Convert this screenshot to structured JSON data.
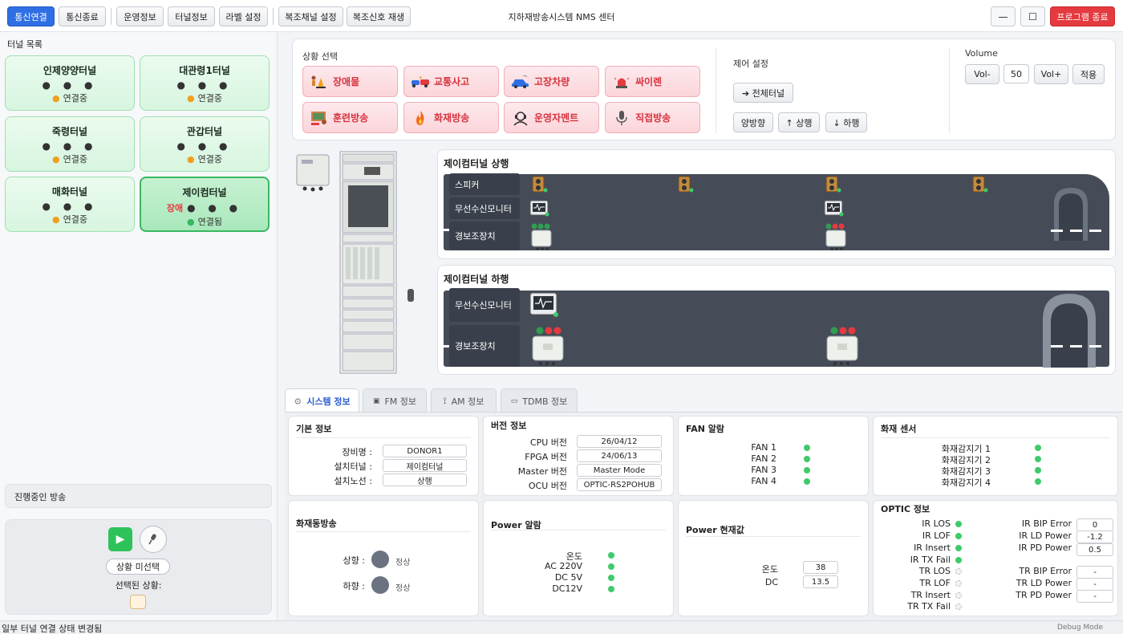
{
  "toolbar": {
    "connect": "통신연결",
    "disconnect": "통신종료",
    "ops_info": "운영정보",
    "tunnel_info": "터널정보",
    "label_settings": "라벨 설정",
    "sub_channel_settings": "복조채널 설정",
    "sub_signal_replay": "복조신호 재생"
  },
  "window": {
    "title": "지하재방송시스템 NMS 센터",
    "minimize": "—",
    "maximize": "☐",
    "exit": "프로그램 종료"
  },
  "tunnel_list": {
    "title": "터널 목록",
    "items": [
      {
        "name": "인제양양터널",
        "dots": "● ● ●",
        "status": "연결중",
        "alarm": ""
      },
      {
        "name": "대관령1터널",
        "dots": "● ● ●",
        "status": "연결중",
        "alarm": ""
      },
      {
        "name": "죽령터널",
        "dots": "● ● ●",
        "status": "연결중",
        "alarm": ""
      },
      {
        "name": "관갑터널",
        "dots": "● ● ●",
        "status": "연결중",
        "alarm": ""
      },
      {
        "name": "매화터널",
        "dots": "● ● ●",
        "status": "연결중",
        "alarm": ""
      },
      {
        "name": "제이컴터널",
        "dots": "● ● ●",
        "status": "연결됨",
        "alarm": "장애"
      }
    ]
  },
  "live_broadcast": {
    "title": "진행중인 방송"
  },
  "control": {
    "no_selection": "상황 미선택",
    "selected_label": "선택된 상황:"
  },
  "scenario": {
    "title": "상황 선택",
    "buttons": [
      {
        "label": "장애물",
        "icon": "obstacle-icon"
      },
      {
        "label": "교통사고",
        "icon": "car-crash-icon"
      },
      {
        "label": "고장차량",
        "icon": "broken-car-icon"
      },
      {
        "label": "싸이렌",
        "icon": "siren-icon"
      },
      {
        "label": "훈련방송",
        "icon": "training-icon"
      },
      {
        "label": "화재방송",
        "icon": "fire-icon"
      },
      {
        "label": "운영자멘트",
        "icon": "operator-icon"
      },
      {
        "label": "직접방송",
        "icon": "microphone-icon"
      }
    ]
  },
  "control_settings": {
    "title": "제어 설정",
    "all_tunnels": "➔ 전체터널",
    "both": "양방향",
    "up": "↑ 상행",
    "down": "↓ 하행"
  },
  "volume": {
    "title": "Volume",
    "minus": "Vol-",
    "value": "50",
    "plus": "Vol+",
    "apply": "적용"
  },
  "tunnel_up": {
    "title": "제이컴터널 상행",
    "rows": [
      "스피커",
      "무선수신모니터",
      "경보조장치"
    ]
  },
  "tunnel_down": {
    "title": "제이컴터널 하행",
    "rows": [
      "무선수신모니터",
      "경보조장치"
    ]
  },
  "tabs": [
    "시스템 정보",
    "FM 정보",
    "AM 정보",
    "TDMB 정보"
  ],
  "basic_info": {
    "title": "기본 정보",
    "rows": [
      {
        "k": "장비명 :",
        "v": "DONOR1"
      },
      {
        "k": "설치터널 :",
        "v": "제이컴터널"
      },
      {
        "k": "설치노선 :",
        "v": "상행"
      }
    ]
  },
  "version_info": {
    "title": "버전 정보",
    "rows": [
      {
        "k": "CPU 버전",
        "v": "26/04/12"
      },
      {
        "k": "FPGA 버전",
        "v": "24/06/13"
      },
      {
        "k": "Master 버전",
        "v": "Master Mode"
      },
      {
        "k": "OCU 버전",
        "v": "OPTIC-RS2POHUB"
      }
    ]
  },
  "fan_alarm": {
    "title": "FAN 알람",
    "rows": [
      "FAN 1",
      "FAN 2",
      "FAN 3",
      "FAN 4"
    ]
  },
  "fire_sensor": {
    "title": "화재 센서",
    "rows": [
      "화재감지기 1",
      "화재감지기 2",
      "화재감지기 3",
      "화재감지기 4"
    ]
  },
  "fire_link": {
    "title": "화재동방송",
    "rows": [
      {
        "k": "상향 :",
        "v": "정상"
      },
      {
        "k": "하향 :",
        "v": "정상"
      }
    ]
  },
  "power_alarm": {
    "title": "Power 알람",
    "rows": [
      "온도",
      "AC 220V",
      "DC 5V",
      "DC12V"
    ]
  },
  "power_now": {
    "title": "Power 현재값",
    "rows": [
      {
        "k": "온도",
        "v": "38"
      },
      {
        "k": "DC",
        "v": "13.5"
      }
    ]
  },
  "optic": {
    "title": "OPTIC 정보",
    "left": [
      {
        "k": "IR LOS",
        "on": true
      },
      {
        "k": "IR LOF",
        "on": true
      },
      {
        "k": "IR Insert",
        "on": true
      },
      {
        "k": "IR TX Fail",
        "on": true
      },
      {
        "k": "TR LOS",
        "on": false
      },
      {
        "k": "TR LOF",
        "on": false
      },
      {
        "k": "TR Insert",
        "on": false
      },
      {
        "k": "TR TX Fail",
        "on": false
      }
    ],
    "right": [
      {
        "k": "IR BIP Error",
        "v": "0"
      },
      {
        "k": "IR LD Power",
        "v": "-1.2"
      },
      {
        "k": "IR PD Power",
        "v": "0.5"
      },
      {
        "k": "TR BIP Error",
        "v": "-"
      },
      {
        "k": "TR LD Power",
        "v": "-"
      },
      {
        "k": "TR PD Power",
        "v": "-"
      }
    ]
  },
  "statusbar": {
    "message": "일부 터널 연결 상태 변경됨",
    "debug": "Debug Mode"
  },
  "colors": {
    "accent": "#2f6fe4",
    "danger": "#e53a3f",
    "ok": "#3fca6b",
    "road": "#454c58"
  }
}
